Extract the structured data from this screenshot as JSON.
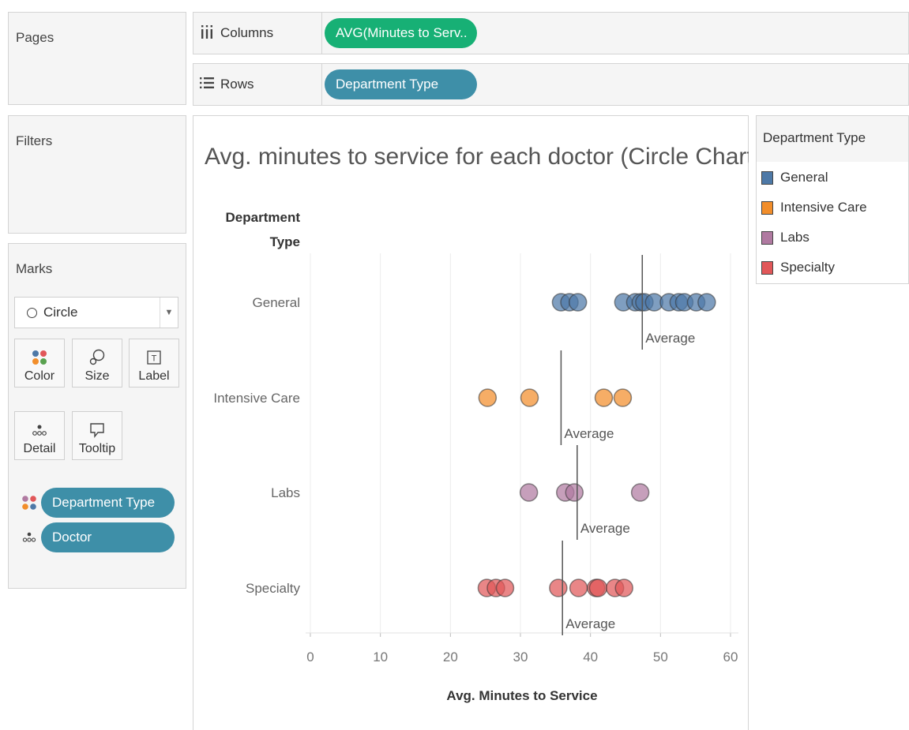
{
  "cards": {
    "pages_label": "Pages",
    "filters_label": "Filters",
    "marks_label": "Marks"
  },
  "shelves": {
    "columns_label": "Columns",
    "columns_pill": "AVG(Minutes to Serv..",
    "rows_label": "Rows",
    "rows_pill": "Department Type"
  },
  "marks": {
    "mark_type": "Circle",
    "buttons": {
      "color": "Color",
      "size": "Size",
      "label": "Label",
      "detail": "Detail",
      "tooltip": "Tooltip"
    },
    "pills": [
      {
        "label": "Department Type",
        "icon": "color-dots-icon"
      },
      {
        "label": "Doctor",
        "icon": "detail-dots-icon"
      }
    ]
  },
  "legend": {
    "title": "Department Type",
    "items": [
      {
        "label": "General",
        "color": "#4e79a7"
      },
      {
        "label": "Intensive Care",
        "color": "#f28e2b"
      },
      {
        "label": "Labs",
        "color": "#b07aa1"
      },
      {
        "label": "Specialty",
        "color": "#e15759"
      }
    ]
  },
  "chart_data": {
    "type": "scatter",
    "title": "Avg. minutes to service for each doctor (Circle Chart)",
    "row_header": [
      "Department",
      "Type"
    ],
    "xlabel": "Avg. Minutes to Service",
    "xlim": [
      0,
      60
    ],
    "xticks": [
      0,
      10,
      20,
      30,
      40,
      50,
      60
    ],
    "grid": true,
    "reference_label": "Average",
    "categories": [
      "General",
      "Intensive Care",
      "Labs",
      "Specialty"
    ],
    "series": [
      {
        "name": "General",
        "color": "#4e79a7",
        "values": [
          35.8,
          37.0,
          38.2,
          44.7,
          46.4,
          47.2,
          47.7,
          49.1,
          51.2,
          52.6,
          53.4,
          55.1,
          56.6
        ],
        "average": 47.4
      },
      {
        "name": "Intensive Care",
        "color": "#f28e2b",
        "values": [
          25.3,
          31.3,
          41.9,
          44.6
        ],
        "average": 35.8
      },
      {
        "name": "Labs",
        "color": "#b07aa1",
        "values": [
          31.2,
          36.4,
          37.7,
          47.1
        ],
        "average": 38.1
      },
      {
        "name": "Specialty",
        "color": "#e15759",
        "values": [
          25.2,
          26.5,
          27.8,
          35.4,
          38.3,
          40.8,
          41.1,
          43.5,
          44.8
        ],
        "average": 36.0
      }
    ]
  }
}
